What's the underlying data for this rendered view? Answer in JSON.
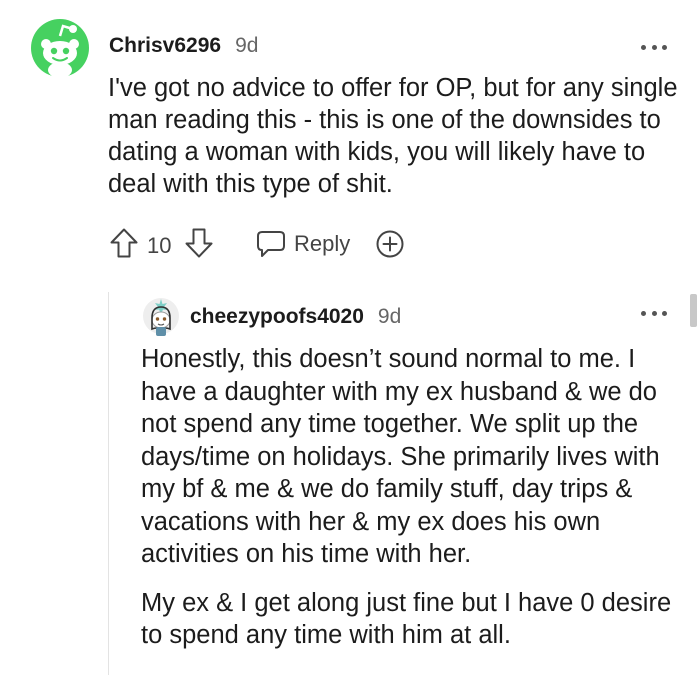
{
  "comment": {
    "author": "Chrisv6296",
    "age": "9d",
    "avatar_icon": "snoo-avatar-icon",
    "avatar_color": "#46d160",
    "body": "I've got no advice to offer for OP, but for any single man reading this - this is one of the downsides to dating a woman with kids, you will likely have to deal with this type of shit.",
    "score": "10",
    "reply_label": "Reply",
    "icons": {
      "upvote": "upvote-arrow-icon",
      "downvote": "downvote-arrow-icon",
      "reply": "speech-bubble-icon",
      "award": "award-plus-icon",
      "more": "more-options-icon"
    }
  },
  "reply": {
    "author": "cheezypoofs4020",
    "age": "9d",
    "avatar_icon": "custom-snoo-avatar-icon",
    "paragraphs": [
      "Honestly, this doesn’t sound normal to me. I have a daughter with my ex husband & we do not spend any time together. We split up the days/time on holidays. She primarily lives with my bf & me & we do family stuff, day trips & vacations with her & my ex does his own activities on his time with her.",
      "My ex & I get along just fine but I have 0 desire to spend any time with him at all."
    ]
  },
  "colors": {
    "text": "#1c1c1c",
    "meta": "#666666",
    "icon": "#444444",
    "thread_line": "#e3e3e3"
  }
}
